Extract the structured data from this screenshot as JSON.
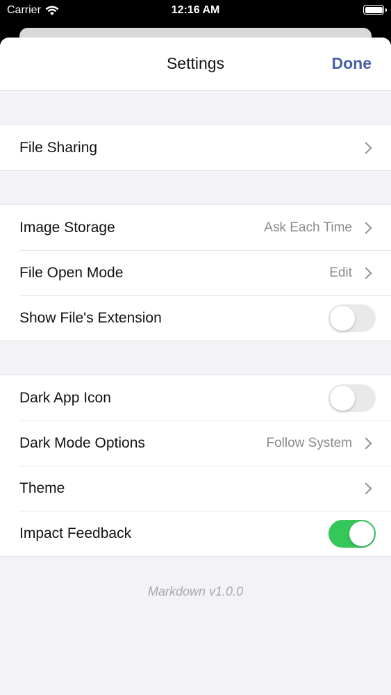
{
  "status_bar": {
    "carrier": "Carrier",
    "time": "12:16 AM",
    "wifi_icon": "wifi-icon",
    "battery_icon": "battery-icon"
  },
  "nav": {
    "title": "Settings",
    "done_label": "Done",
    "done_color": "#4a5ea8"
  },
  "groups": [
    {
      "rows": [
        {
          "label": "File Sharing",
          "accessory": "chevron"
        }
      ]
    },
    {
      "rows": [
        {
          "label": "Image Storage",
          "value": "Ask Each Time",
          "accessory": "chevron"
        },
        {
          "label": "File Open Mode",
          "value": "Edit",
          "accessory": "chevron"
        },
        {
          "label": "Show File's Extension",
          "accessory": "toggle",
          "on": false
        }
      ]
    },
    {
      "rows": [
        {
          "label": "Dark App Icon",
          "accessory": "toggle",
          "on": false
        },
        {
          "label": "Dark Mode Options",
          "value": "Follow System",
          "accessory": "chevron"
        },
        {
          "label": "Theme",
          "accessory": "chevron"
        },
        {
          "label": "Impact Feedback",
          "accessory": "toggle",
          "on": true
        }
      ]
    }
  ],
  "footer": {
    "version": "Markdown v1.0.0"
  },
  "colors": {
    "toggle_on": "#34c759",
    "toggle_off": "#e9e9eb",
    "grouped_background": "#f2f2f7"
  }
}
